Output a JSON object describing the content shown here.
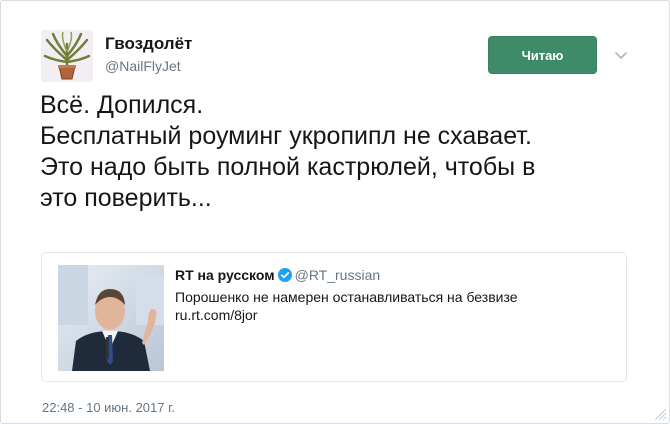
{
  "tweet": {
    "author": {
      "display_name": "Гвоздолёт",
      "handle": "@NailFlyJet"
    },
    "follow_button_label": "Читаю",
    "text_lines": [
      "Всё. Допился.",
      "Бесплатный роуминг укропипл не схавает.",
      "Это надо быть полной кастрюлей, чтобы в",
      "это поверить..."
    ],
    "quoted": {
      "name": "RT на русском",
      "handle": "@RT_russian",
      "text": "Порошенко не намерен останавливаться на безвизе",
      "link": "ru.rt.com/8jor"
    },
    "timestamp": "22:48 - 10 июн. 2017 г."
  },
  "colors": {
    "follow_button": "#3f8b69",
    "verified_badge": "#1da1f2",
    "secondary_text": "#657786"
  },
  "icons": {
    "avatar": "palm-plant-avatar",
    "chevron": "chevron-down-icon",
    "verified": "verified-badge-icon"
  }
}
